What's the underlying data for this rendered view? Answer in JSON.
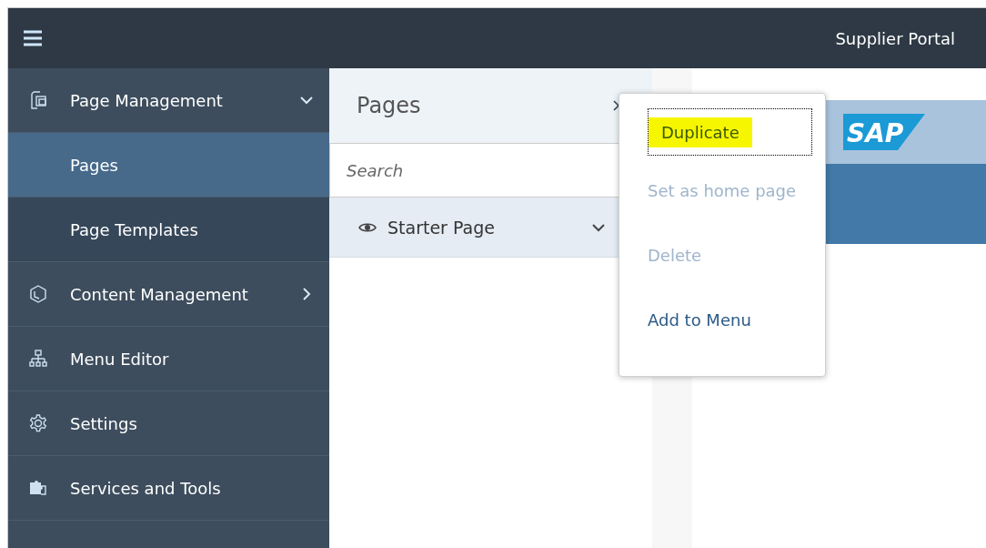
{
  "header": {
    "title": "Supplier Portal"
  },
  "sidebar": {
    "items": [
      {
        "label": "Page Management",
        "expanded": true,
        "children": [
          {
            "label": "Pages",
            "selected": true
          },
          {
            "label": "Page Templates",
            "selected": false
          }
        ]
      },
      {
        "label": "Content Management",
        "expanded": false
      },
      {
        "label": "Menu Editor"
      },
      {
        "label": "Settings"
      },
      {
        "label": "Services and Tools"
      }
    ]
  },
  "pages_panel": {
    "title": "Pages",
    "search": {
      "placeholder": "Search"
    },
    "rows": [
      {
        "label": "Starter Page"
      }
    ]
  },
  "preview": {
    "logo": "SAP"
  },
  "context_menu": {
    "items": [
      {
        "label": "Duplicate",
        "disabled": false,
        "highlighted": true
      },
      {
        "label": "Set as home page",
        "disabled": true,
        "highlighted": false
      },
      {
        "label": "Delete",
        "disabled": true,
        "highlighted": false
      },
      {
        "label": "Add to Menu",
        "disabled": false,
        "highlighted": false
      }
    ]
  }
}
